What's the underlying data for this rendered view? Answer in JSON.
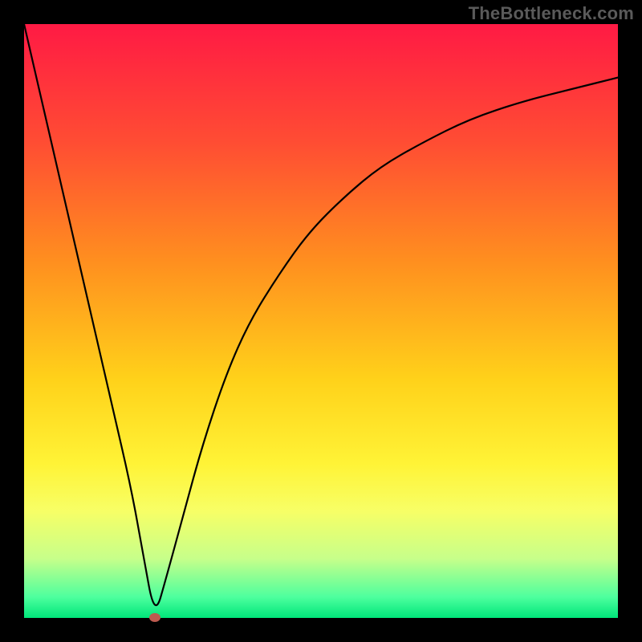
{
  "watermark": "TheBottleneck.com",
  "colors": {
    "black_border": "#000000",
    "watermark_text": "#5a5a5a",
    "marker": "#bd5a4f",
    "gradient_stops": [
      {
        "offset": 0.0,
        "color": "#ff1a44"
      },
      {
        "offset": 0.2,
        "color": "#ff4d33"
      },
      {
        "offset": 0.4,
        "color": "#ff8f1f"
      },
      {
        "offset": 0.6,
        "color": "#ffd21a"
      },
      {
        "offset": 0.74,
        "color": "#fff336"
      },
      {
        "offset": 0.82,
        "color": "#f7ff66"
      },
      {
        "offset": 0.9,
        "color": "#c7ff8a"
      },
      {
        "offset": 0.965,
        "color": "#4dff9e"
      },
      {
        "offset": 1.0,
        "color": "#00e67a"
      }
    ]
  },
  "chart_data": {
    "type": "line",
    "title": "",
    "xlabel": "",
    "ylabel": "",
    "xlim": [
      0,
      100
    ],
    "ylim": [
      0,
      100
    ],
    "legend": [],
    "note": "Background is a vertical red→orange→yellow→green gradient. Curve is black. A small red-brown dot marks the trough at x≈22, y≈0.",
    "series": [
      {
        "name": "curve",
        "x": [
          0,
          3,
          6,
          9,
          12,
          15,
          18,
          20,
          22,
          24,
          27,
          30,
          34,
          38,
          43,
          48,
          54,
          60,
          67,
          75,
          84,
          92,
          100
        ],
        "values": [
          100,
          87,
          74,
          61,
          48,
          35,
          22,
          11,
          0,
          7,
          18,
          29,
          41,
          50,
          58,
          65,
          71,
          76,
          80,
          84,
          87,
          89,
          91
        ]
      }
    ],
    "marker": {
      "x": 22,
      "y": 0
    }
  }
}
